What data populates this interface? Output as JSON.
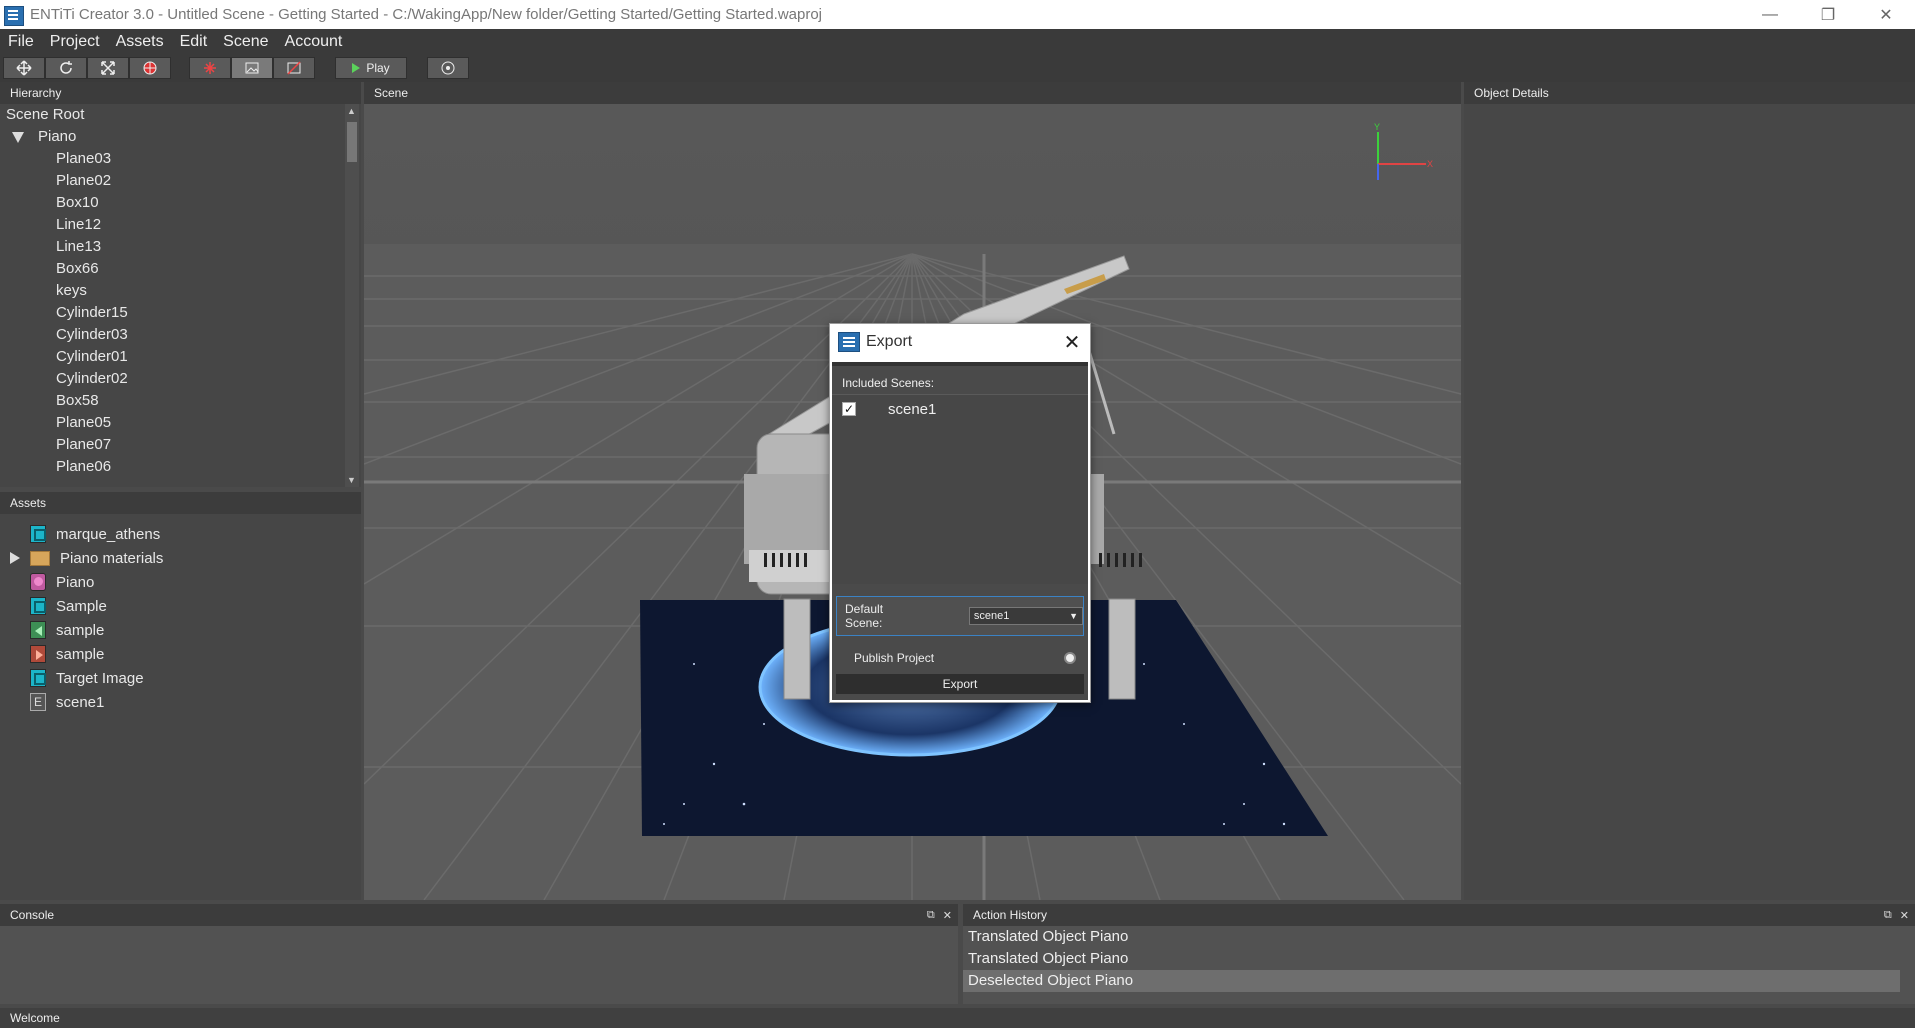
{
  "window": {
    "title": "ENTiTi Creator 3.0 - Untitled Scene - Getting Started - C:/WakingApp/New folder/Getting Started/Getting Started.waproj",
    "minimize": "—",
    "maximize": "❐",
    "close": "✕"
  },
  "menu": [
    "File",
    "Project",
    "Assets",
    "Edit",
    "Scene",
    "Account"
  ],
  "toolbar": {
    "play_label": "Play"
  },
  "hierarchy": {
    "title": "Hierarchy",
    "root": "Scene Root",
    "group": "Piano",
    "children": [
      "Plane03",
      "Plane02",
      "Box10",
      "Line12",
      "Line13",
      "Box66",
      "keys",
      "Cylinder15",
      "Cylinder03",
      "Cylinder01",
      "Cylinder02",
      "Box58",
      "Plane05",
      "Plane07",
      "Plane06"
    ]
  },
  "assets": {
    "title": "Assets",
    "items": [
      {
        "name": "marque_athens",
        "icon": "texture-icon"
      },
      {
        "name": "Piano materials",
        "icon": "folder-icon"
      },
      {
        "name": "Piano",
        "icon": "model-icon"
      },
      {
        "name": "Sample",
        "icon": "texture-icon"
      },
      {
        "name": "sample",
        "icon": "audio-icon"
      },
      {
        "name": "sample",
        "icon": "video-icon"
      },
      {
        "name": "Target Image",
        "icon": "texture-icon"
      },
      {
        "name": "scene1",
        "icon": "scene-icon"
      }
    ]
  },
  "scene": {
    "title": "Scene",
    "axis_x": "X",
    "axis_y": "Y"
  },
  "details": {
    "title": "Object Details"
  },
  "console": {
    "title": "Console"
  },
  "history": {
    "title": "Action History",
    "items": [
      "Translated Object Piano",
      "Translated Object Piano",
      "Deselected Object Piano"
    ],
    "selected_index": 2
  },
  "status": {
    "text": "Welcome"
  },
  "dialog": {
    "title": "Export",
    "close": "✕",
    "included_label": "Included Scenes:",
    "scenes": [
      {
        "name": "scene1",
        "checked": true
      }
    ],
    "default_scene_label": "Default Scene:",
    "default_scene_value": "scene1",
    "publish_label": "Publish Project",
    "export_button": "Export"
  },
  "colors": {
    "panel": "#464646",
    "header": "#3c3c3c",
    "accent": "#3b82c4"
  }
}
